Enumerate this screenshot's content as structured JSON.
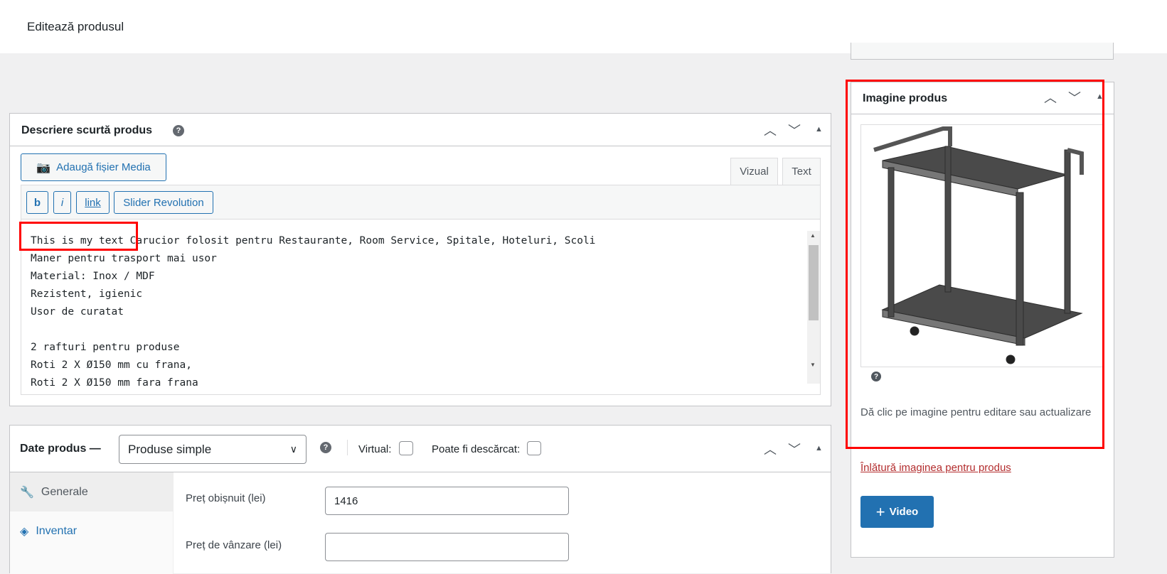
{
  "header": {
    "title": "Editează produsul"
  },
  "short_desc": {
    "title": "Descriere scurtă produs",
    "help_icon": "question-icon",
    "add_media": "Adaugă fișier Media",
    "tabs": [
      "Vizual",
      "Text"
    ],
    "toolbar": [
      "b",
      "i",
      "link",
      "Slider Revolution"
    ],
    "lines": [
      "This is my text Carucior folosit pentru Restaurante, Room Service, Spitale, Hoteluri, Scoli",
      "Maner pentru trasport mai usor",
      "Material: Inox / MDF",
      "Rezistent, igienic",
      "Usor de curatat",
      "",
      "2 rafturi pentru produse",
      "Roti 2 X Ø150 mm cu frana,",
      "Roti 2 X Ø150 mm fara frana"
    ]
  },
  "product_data": {
    "title": "Date produs —",
    "type_select": "Produse simple",
    "virtual_label": "Virtual:",
    "downloadable_label": "Poate fi descărcat:",
    "tabs": [
      "Generale",
      "Inventar"
    ],
    "fields": [
      {
        "label": "Preț obișnuit (lei)",
        "value": "1416"
      },
      {
        "label": "Preț de vânzare (lei)",
        "value": ""
      }
    ]
  },
  "product_image": {
    "title": "Imagine produs",
    "hint": "Dă clic pe imagine pentru editare sau actualizare",
    "remove_link": "Înlătură imaginea pentru produs",
    "video_button": "Video"
  },
  "colors": {
    "accent": "#2271b1",
    "highlight": "#ff0000",
    "remove_link": "#b32d2e"
  }
}
